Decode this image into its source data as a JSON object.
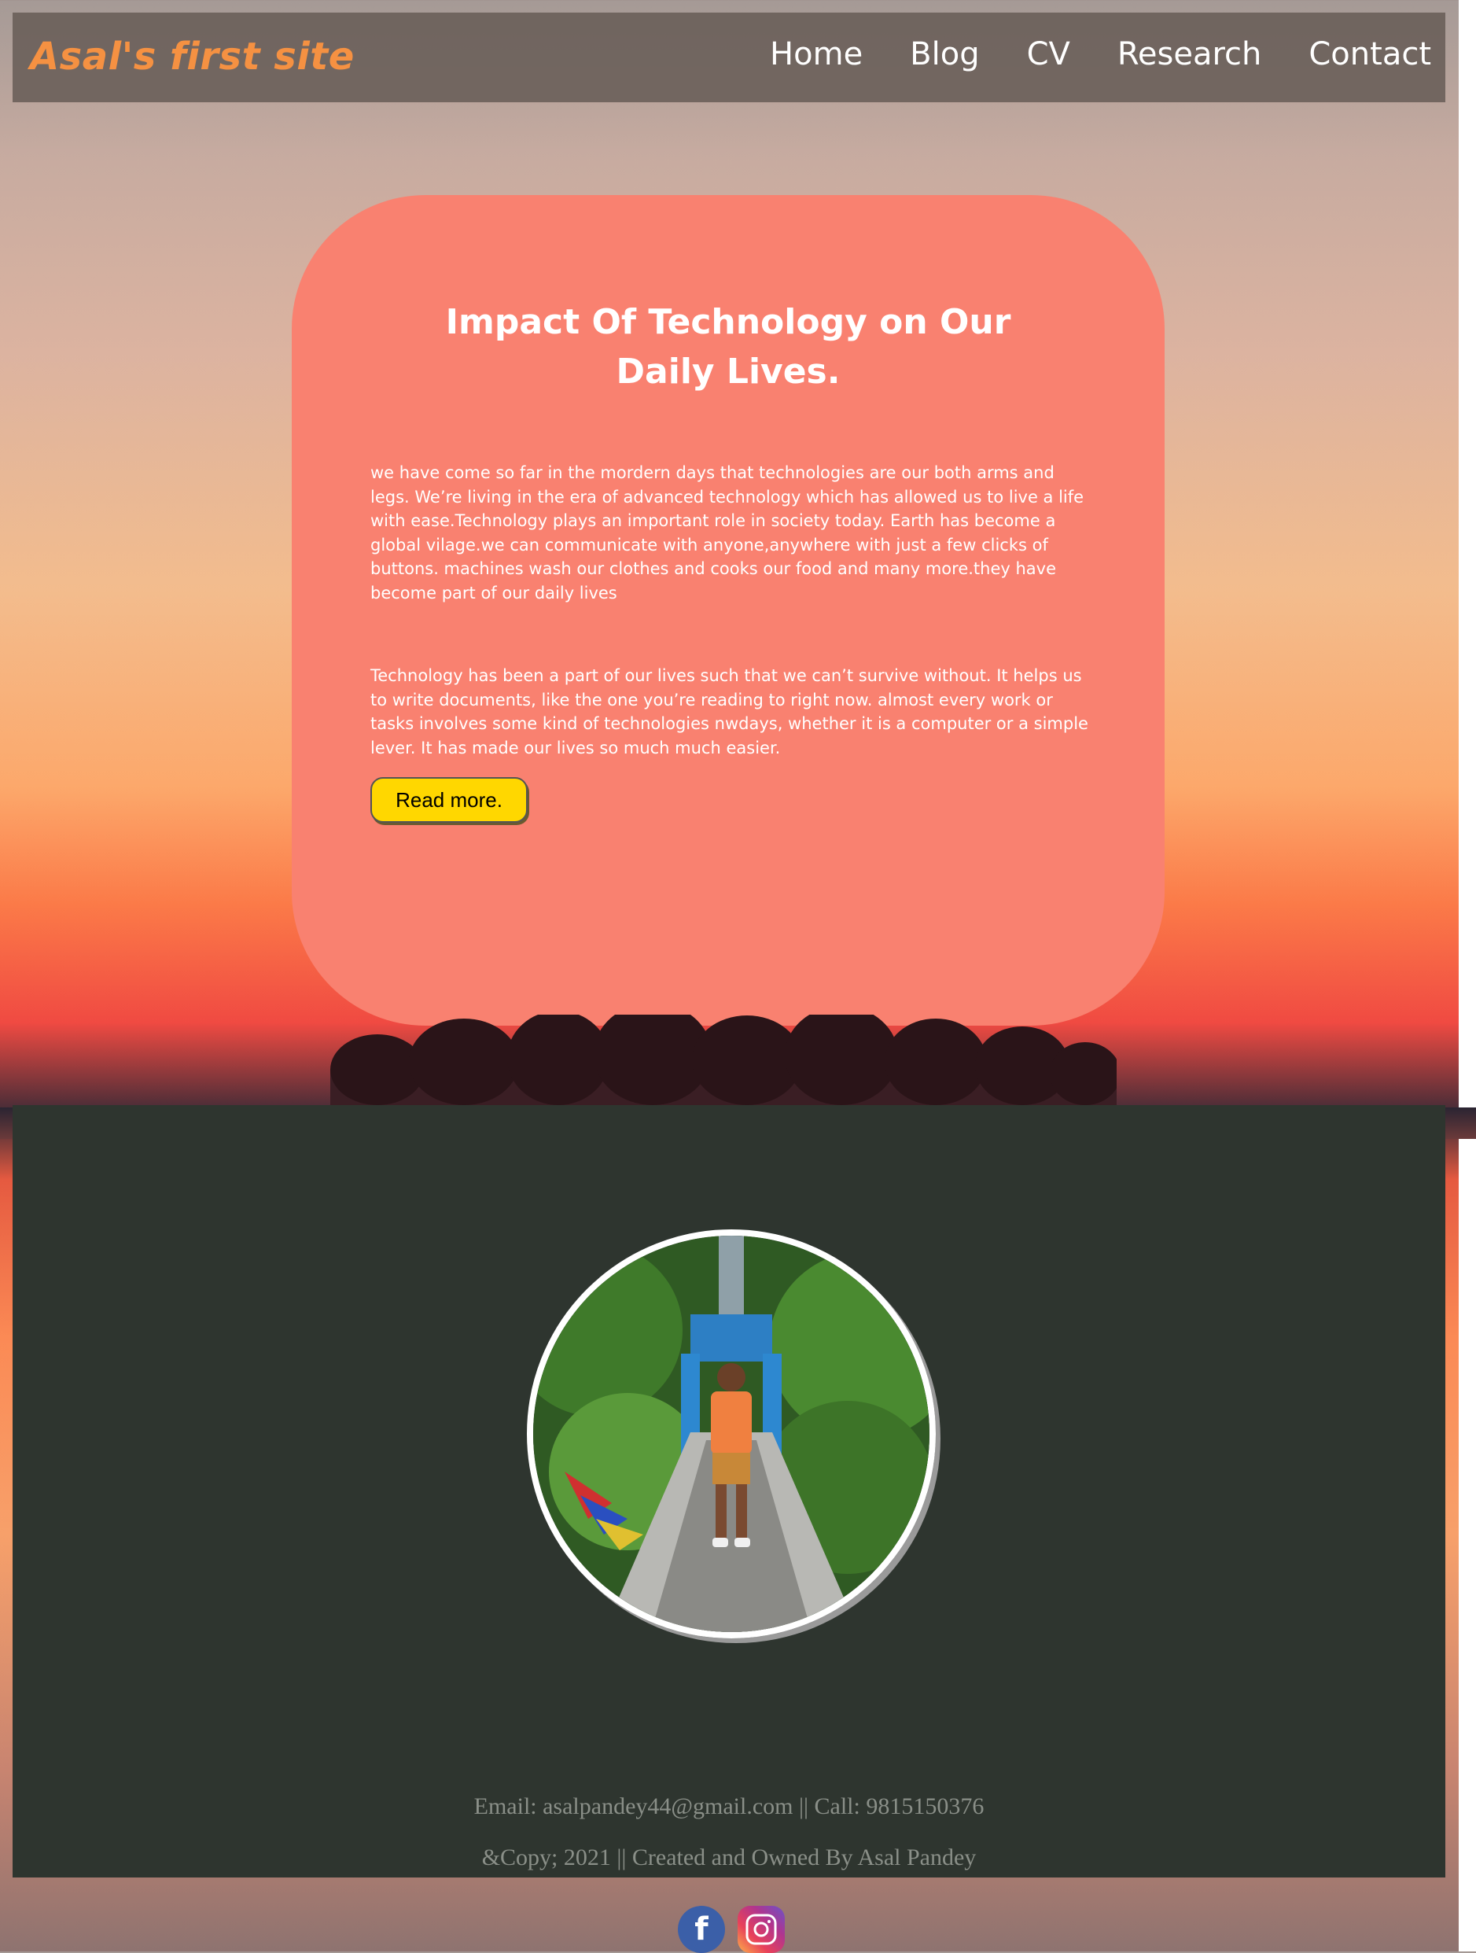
{
  "header": {
    "brand": "Asal's first site",
    "nav": [
      "Home",
      "Blog",
      "CV",
      "Research",
      "Contact"
    ]
  },
  "article": {
    "title": "Impact Of Technology on Our Daily Lives.",
    "paragraph1": "we have come so far in the mordern days that technologies are our both arms and legs. We’re living in the era of advanced technology which has allowed us to live a life with ease.Technology plays an important role in society today. Earth has become a global vilage.we can communicate with anyone,anywhere with just a few clicks of buttons. machines wash our clothes and cooks our food and many more.they have become part of our daily lives",
    "paragraph2": "Technology has been a part of our lives such that we can’t survive without. It helps us to write documents, like the one you’re reading to right now. almost every work or tasks involves some kind of technologies nwdays, whether it is a computer or a simple lever. It has made our lives so much much easier.",
    "read_more": "Read more."
  },
  "footer": {
    "contact": "Email: asalpandey44@gmail.com || Call: 9815150376",
    "copyright": "&Copy; 2021 || Created and Owned By Asal Pandey",
    "social": [
      "facebook-icon",
      "instagram-icon"
    ]
  },
  "colors": {
    "brand": "#f59142",
    "card": "#f98170",
    "button": "#ffd700",
    "footer_bg": "#2e352f"
  }
}
